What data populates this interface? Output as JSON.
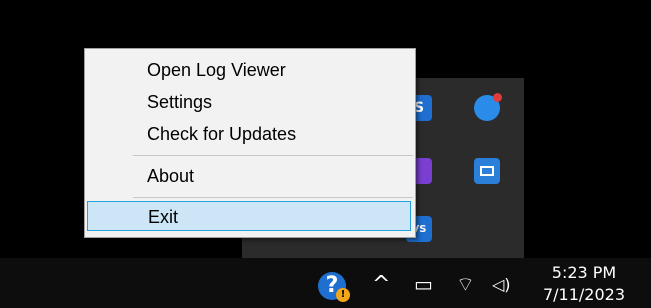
{
  "context_menu": {
    "items": [
      {
        "label": "Open Log Viewer"
      },
      {
        "label": "Settings"
      },
      {
        "label": "Check for Updates"
      },
      {
        "label": "About"
      },
      {
        "label": "Exit"
      }
    ],
    "highlighted": "Exit",
    "highlight_color": "#cde6f7",
    "highlight_border": "#26a0da"
  },
  "tray_overflow": {
    "icons": [
      {
        "name": "s-app-icon",
        "text": "S",
        "color": "#1e6fd0"
      },
      {
        "name": "cloud-badge-icon",
        "text": "",
        "color": "#2b8be8"
      },
      {
        "name": "purple-app-icon",
        "text": "",
        "color": "#7a3fd1"
      },
      {
        "name": "screen-app-icon",
        "text": "",
        "color": "#2a7fd8"
      },
      {
        "name": "vs-app-icon",
        "text": "VS",
        "color": "#1e6fd0"
      }
    ]
  },
  "taskbar": {
    "help_icon_text": "?",
    "badge_text": "!",
    "chevron": "^",
    "battery": "▭",
    "wifi": "⌔",
    "volume": "◁)",
    "clock": {
      "time": "5:23 PM",
      "date": "7/11/2023"
    }
  }
}
